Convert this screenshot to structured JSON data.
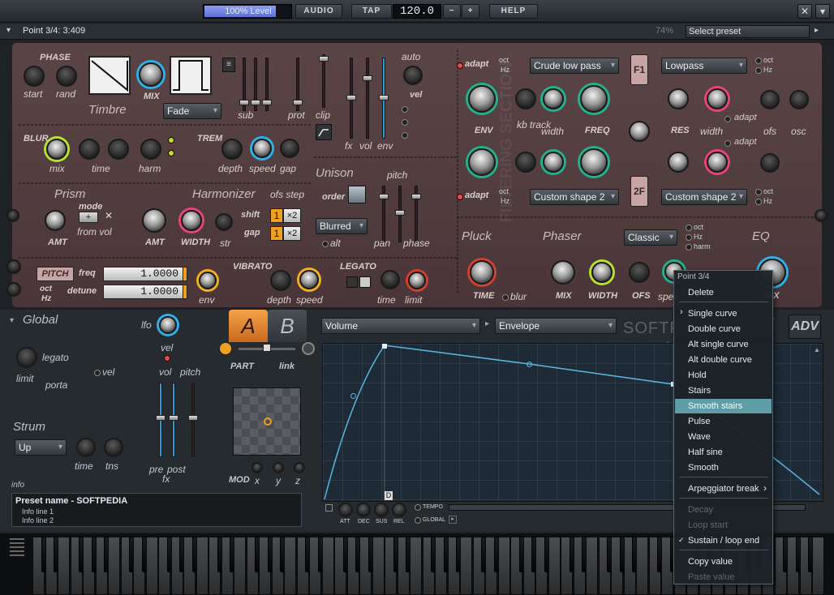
{
  "topbar": {
    "level_label": "100% Level",
    "level_pct": 100,
    "audio_label": "AUDIO",
    "tap_label": "TAP",
    "tempo_value": "120.0",
    "minus_label": "−",
    "plus_label": "+",
    "help_label": "HELP",
    "close_symbol": "✕",
    "menu_symbol": "▾"
  },
  "hintbar": {
    "hint": "Point 3/4: 3:409",
    "zoom": "74%",
    "preset_placeholder": "Select preset"
  },
  "timbre": {
    "phase_label": "PHASE",
    "start_label": "start",
    "rand_label": "rand",
    "mix_label": "MIX",
    "title": "Timbre",
    "fade_value": "Fade",
    "sub_label": "sub",
    "prot_label": "prot",
    "clip_label": "clip",
    "fx_label": "fx",
    "vol_label": "vol",
    "env_label": "env",
    "auto_label": "auto",
    "vel_label": "vel"
  },
  "blur": {
    "title": "BLUR",
    "mix_label": "mix",
    "time_label": "time",
    "harm_label": "harm",
    "trem_title": "TREM",
    "depth_label": "depth",
    "speed_label": "speed",
    "gap_label": "gap"
  },
  "prism": {
    "title": "Prism",
    "mode_label": "mode",
    "from_vol_label": "from vol",
    "amt_label": "AMT"
  },
  "harmonizer": {
    "title": "Harmonizer",
    "amt_label": "AMT",
    "width_label": "WIDTH",
    "str_label": "str",
    "ofs_step_label": "ofs step",
    "shift_label": "shift",
    "gap_label": "gap",
    "shift_value": "1",
    "gap_value": "1",
    "times2": "×2"
  },
  "unison": {
    "title": "Unison",
    "order_label": "order",
    "pitch_label": "pitch",
    "blurred_value": "Blurred",
    "alt_label": "alt",
    "pan_label": "pan",
    "phase_label": "phase"
  },
  "pitch": {
    "badge": "PITCH",
    "freq_label": "freq",
    "detune_label": "detune",
    "freq_value": "1.0000",
    "detune_value": "1.0000",
    "oct_label": "oct",
    "hz_label": "Hz",
    "env_label": "env",
    "vibrato_title": "VIBRATO",
    "depth_label": "depth",
    "speed_label": "speed",
    "legato_title": "LEGATO",
    "time_label": "time",
    "limit_label": "limit"
  },
  "filter": {
    "section_watermark": "FILTERING SECTION",
    "adapt_label": "adapt",
    "oct_label": "oct",
    "hz_label": "Hz",
    "f1_type": "Crude low pass",
    "f1_mode": "Lowpass",
    "f2_type": "Custom shape 2",
    "f2_mode": "Custom shape 2",
    "env_label": "ENV",
    "kb_track_label": "kb\ntrack",
    "width_label": "width",
    "freq_label": "FREQ",
    "res_label": "RES",
    "ofs_label": "ofs",
    "osc_label": "osc",
    "f1_badge": "F1",
    "f2_badge": "2F"
  },
  "pluck": {
    "title": "Pluck",
    "time_label": "TIME",
    "blur_label": "blur"
  },
  "phaser": {
    "title": "Phaser",
    "mode_value": "Classic",
    "mix_label": "MIX",
    "width_label": "WIDTH",
    "ofs_label": "OFS",
    "speed_label": "spee",
    "oct_label": "oct",
    "hz_label": "Hz",
    "harm_label": "harm"
  },
  "eq": {
    "title": "EQ",
    "mix_label": "MIX"
  },
  "global": {
    "title": "Global",
    "lfo_label": "lfo",
    "vel_label": "vel",
    "legato_label": "legato",
    "porta_label": "porta",
    "limit_label": "limit",
    "vol_label": "vol",
    "pitch_label": "pitch",
    "strum_title": "Strum",
    "strum_value": "Up",
    "time_label": "time",
    "tns_label": "tns",
    "pre_label": "pre",
    "post_label": "post",
    "fx_label": "fx",
    "part_label": "PART",
    "link_label": "link",
    "mod_label": "MOD",
    "x_label": "x",
    "y_label": "y",
    "z_label": "z"
  },
  "tabs": {
    "a_label": "A",
    "b_label": "B",
    "fx_label": "FX",
    "adv_label": "ADV"
  },
  "envelope": {
    "target_value": "Volume",
    "type_value": "Envelope",
    "marker": "D",
    "att_label": "ATT",
    "dec_label": "DEC",
    "sus_label": "SUS",
    "rel_label": "REL",
    "tempo_label": "TEMPO",
    "global_label": "GLOBAL",
    "watermark": "SOFTPEDIA",
    "watermark_url": "www.softpedia.com"
  },
  "info": {
    "header": "info",
    "preset_name": "Preset name - SOFTPEDIA",
    "line1": "Info line 1",
    "line2": "Info line 2"
  },
  "context_menu": {
    "header": "Point 3/4",
    "items": [
      {
        "label": "Delete",
        "state": "normal"
      },
      {
        "label": "Single curve",
        "state": "normal"
      },
      {
        "label": "Double curve",
        "state": "normal"
      },
      {
        "label": "Alt single curve",
        "state": "normal"
      },
      {
        "label": "Alt double curve",
        "state": "normal"
      },
      {
        "label": "Hold",
        "state": "normal"
      },
      {
        "label": "Stairs",
        "state": "normal"
      },
      {
        "label": "Smooth stairs",
        "state": "highlighted"
      },
      {
        "label": "Pulse",
        "state": "normal"
      },
      {
        "label": "Wave",
        "state": "normal"
      },
      {
        "label": "Half sine",
        "state": "normal"
      },
      {
        "label": "Smooth",
        "state": "normal"
      },
      {
        "label": "Arpeggiator break",
        "state": "submenu"
      },
      {
        "label": "Decay",
        "state": "disabled"
      },
      {
        "label": "Loop start",
        "state": "disabled"
      },
      {
        "label": "Sustain / loop end",
        "state": "checked"
      },
      {
        "label": "Copy value",
        "state": "normal"
      },
      {
        "label": "Paste value",
        "state": "disabled"
      }
    ]
  },
  "colors": {
    "panel": "#5a4446",
    "accent_orange": "#f0a020",
    "envelope_line": "#5ab8e0",
    "menu_highlight": "#5f9ea6"
  }
}
